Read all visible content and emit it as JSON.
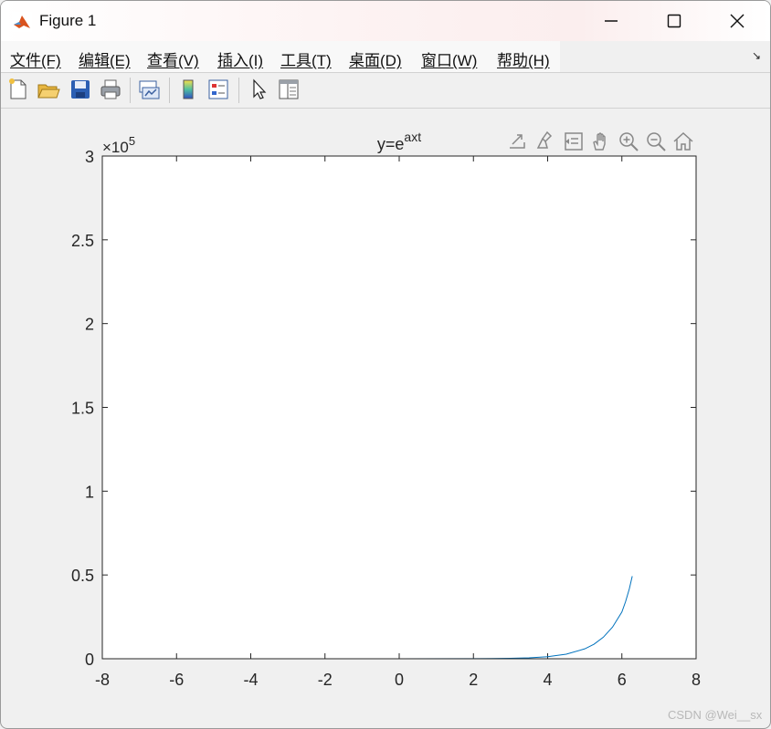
{
  "window": {
    "title": "Figure 1",
    "controls": [
      "minimize",
      "maximize",
      "close"
    ]
  },
  "menu": {
    "items": [
      "文件(F)",
      "编辑(E)",
      "查看(V)",
      "插入(I)",
      "工具(T)",
      "桌面(D)",
      "窗口(W)",
      "帮助(H)"
    ]
  },
  "toolbar": {
    "icons": [
      "new-figure-icon",
      "open-file-icon",
      "save-icon",
      "print-icon",
      "link-plot-icon",
      "colorbar-icon",
      "legend-icon",
      "pointer-icon",
      "property-inspector-icon"
    ]
  },
  "axes_toolbar": {
    "icons": [
      "export-icon",
      "brush-icon",
      "data-tips-icon",
      "pan-icon",
      "zoom-in-icon",
      "zoom-out-icon",
      "home-icon"
    ]
  },
  "chart_data": {
    "type": "line",
    "title": "y=e",
    "title_superscript": "axt",
    "xlabel": "",
    "ylabel": "",
    "xlim": [
      -8,
      8
    ],
    "ylim": [
      0,
      3
    ],
    "x_ticks": [
      "-8",
      "-6",
      "-4",
      "-2",
      "0",
      "2",
      "4",
      "6",
      "8"
    ],
    "y_ticks": [
      "0",
      "0.5",
      "1",
      "1.5",
      "2",
      "2.5",
      "3"
    ],
    "y_exponent_base": "×10",
    "y_exponent_power": "5",
    "grid": false,
    "line_color": "#0072bd",
    "series": [
      {
        "x": [
          -6.28,
          0,
          2.0,
          2.5,
          3.0,
          3.5,
          4.0,
          4.5,
          5.0,
          5.25,
          5.5,
          5.75,
          6.0,
          6.1,
          6.2,
          6.28
        ],
        "y": [
          0.0,
          0.0,
          0.0005,
          0.0012,
          0.0026,
          0.0057,
          0.0125,
          0.0272,
          0.059,
          0.087,
          0.1283,
          0.1892,
          0.2791,
          0.341,
          0.4166,
          0.493
        ]
      }
    ]
  },
  "watermark": "CSDN @Wei__sx"
}
